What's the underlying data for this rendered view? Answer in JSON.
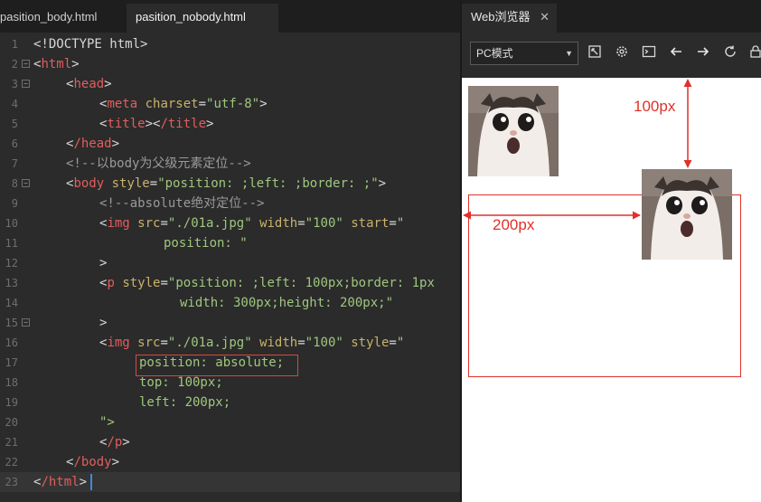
{
  "editor": {
    "tabs": [
      {
        "label": "pasition_body.html",
        "active": false
      },
      {
        "label": "pasition_nobody.html",
        "active": true
      }
    ],
    "line_numbers": [
      "1",
      "2",
      "3",
      "4",
      "5",
      "6",
      "7",
      "8",
      "9",
      "10",
      "11",
      "12",
      "13",
      "14",
      "15",
      "16",
      "17",
      "18",
      "19",
      "20",
      "21",
      "22",
      "23"
    ],
    "lines": {
      "l1": "<!DOCTYPE html>",
      "l2": "html",
      "l3": "head",
      "l4": {
        "tag": "meta",
        "attr": "charset",
        "value": "\"utf-8\""
      },
      "l5": {
        "open": "title",
        "close": "/title"
      },
      "l6": "/head",
      "l7": "<!--以body为父级元素定位-->",
      "l8": {
        "tag": "body",
        "attr": "style",
        "value": "\"position: ;left: ;border: ;\""
      },
      "l9": "<!--absolute绝对定位-->",
      "l10": {
        "tag": "img",
        "a1": "src",
        "v1": "\"./01a.jpg\"",
        "a2": "width",
        "v2": "\"100\"",
        "a3": "start",
        "v3": "\""
      },
      "l11": "position: \"",
      "l12": ">",
      "l13": {
        "tag": "p",
        "attr": "style",
        "value": "\"position: ;left: 100px;border: 1px"
      },
      "l14": "width: 300px;height: 200px;\"",
      "l15": ">",
      "l16": {
        "tag": "img",
        "a1": "src",
        "v1": "\"./01a.jpg\"",
        "a2": "width",
        "v2": "\"100\"",
        "a3": "style",
        "v3": "\""
      },
      "l17": "position: absolute;",
      "l18": "top: 100px;",
      "l19": "left: 200px;",
      "l20": "\">",
      "l21": "/p",
      "l22": "/body",
      "l23": "/html"
    }
  },
  "browser": {
    "tab_label": "Web浏览器",
    "tab_close": "✕",
    "mode_select": "PC模式",
    "toolbar_icons": [
      "expand-icon",
      "settings-icon",
      "console-icon",
      "back-arrow-icon",
      "forward-arrow-icon",
      "refresh-icon",
      "lock-icon"
    ],
    "annotations": {
      "top_offset": "100px",
      "left_offset": "200px"
    },
    "accent_color": "#e0302a"
  }
}
